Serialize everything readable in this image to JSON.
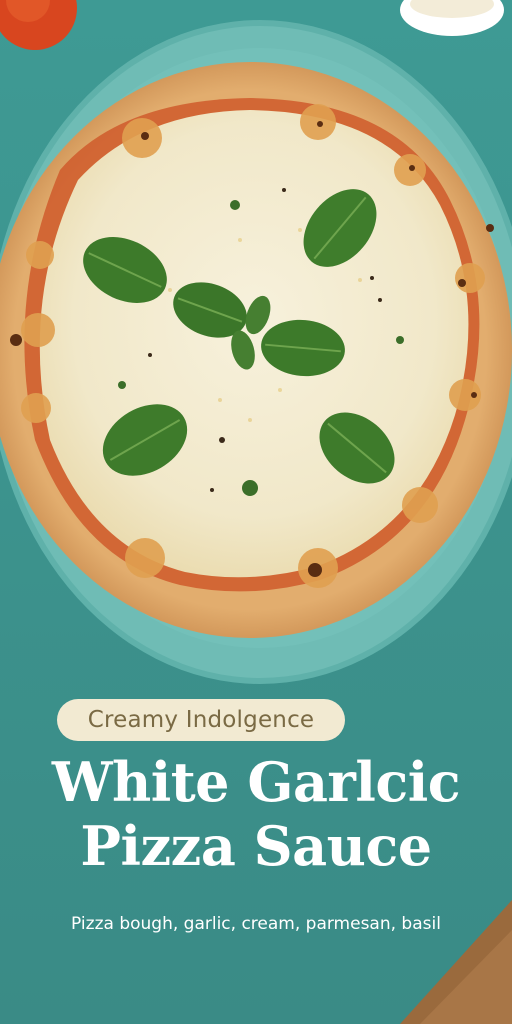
{
  "badge": {
    "text": "Creamy Indolgence"
  },
  "title": {
    "line1": "White Garlcic",
    "line2": "Pizza Sauce"
  },
  "subtitle": {
    "text": "Pizza bough, garlic, cream, parmesan, basil"
  },
  "colors": {
    "tablecloth": "#3f958f",
    "plate_rim": "#6fbcb5",
    "crust": "#d9a066",
    "cheese": "#f3ecd3",
    "basil": "#3f7a2c",
    "badge_bg": "#f2ead2",
    "badge_text": "#7a6a44",
    "title_text": "#ffffff"
  },
  "scene": {
    "description_items": [
      "pizza",
      "plate",
      "tablecloth",
      "basil-leaves",
      "tomato",
      "parmesan-bowl",
      "wooden-table"
    ]
  }
}
